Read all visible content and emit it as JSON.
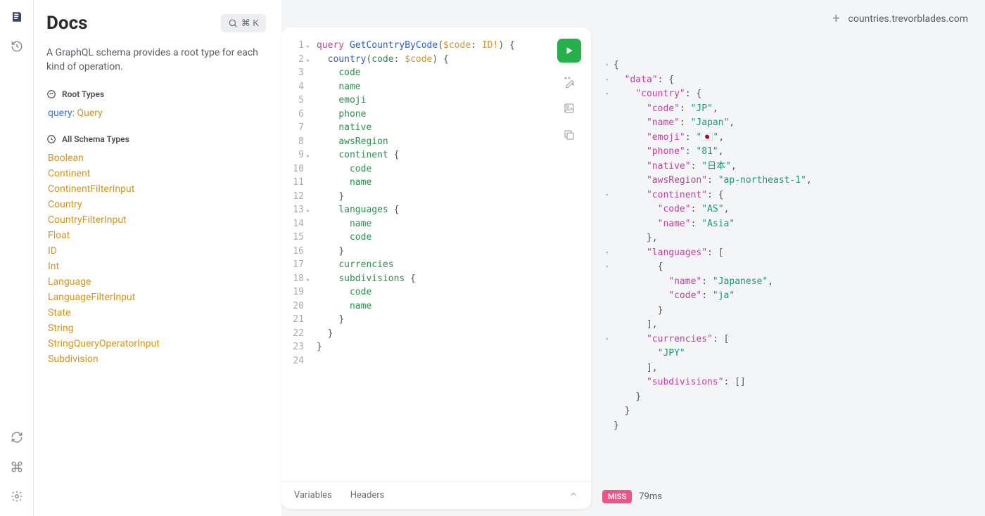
{
  "docs": {
    "title": "Docs",
    "description": "A GraphQL schema provides a root type for each kind of operation.",
    "search_shortcut": "⌘ K",
    "root_types_label": "Root Types",
    "root_type": {
      "label": "query:",
      "type": "Query"
    },
    "all_schema_types_label": "All Schema Types",
    "schema_types": [
      "Boolean",
      "Continent",
      "ContinentFilterInput",
      "Country",
      "CountryFilterInput",
      "Float",
      "ID",
      "Int",
      "Language",
      "LanguageFilterInput",
      "State",
      "String",
      "StringQueryOperatorInput",
      "Subdivision"
    ]
  },
  "endpoint": "countries.trevorblades.com",
  "editor": {
    "lines": [
      {
        "num": "1",
        "fold": true,
        "tokens": [
          [
            "kw",
            "query "
          ],
          [
            "name",
            "GetCountryByCode"
          ],
          [
            "punc",
            "("
          ],
          [
            "var",
            "$code"
          ],
          [
            "punc",
            ": "
          ],
          [
            "type",
            "ID!"
          ],
          [
            "punc",
            ") {"
          ]
        ]
      },
      {
        "num": "2",
        "fold": true,
        "indent": 1,
        "tokens": [
          [
            "name",
            "country"
          ],
          [
            "punc",
            "("
          ],
          [
            "prop",
            "code"
          ],
          [
            "punc",
            ": "
          ],
          [
            "var",
            "$code"
          ],
          [
            "punc",
            ") {"
          ]
        ]
      },
      {
        "num": "3",
        "indent": 2,
        "tokens": [
          [
            "prop",
            "code"
          ]
        ]
      },
      {
        "num": "4",
        "indent": 2,
        "tokens": [
          [
            "prop",
            "name"
          ]
        ]
      },
      {
        "num": "5",
        "indent": 2,
        "tokens": [
          [
            "prop",
            "emoji"
          ]
        ]
      },
      {
        "num": "6",
        "indent": 2,
        "tokens": [
          [
            "prop",
            "phone"
          ]
        ]
      },
      {
        "num": "7",
        "indent": 2,
        "tokens": [
          [
            "prop",
            "native"
          ]
        ]
      },
      {
        "num": "8",
        "indent": 2,
        "tokens": [
          [
            "prop",
            "awsRegion"
          ]
        ]
      },
      {
        "num": "9",
        "fold": true,
        "indent": 2,
        "tokens": [
          [
            "prop",
            "continent"
          ],
          [
            "punc",
            " {"
          ]
        ]
      },
      {
        "num": "10",
        "indent": 3,
        "tokens": [
          [
            "prop",
            "code"
          ]
        ]
      },
      {
        "num": "11",
        "indent": 3,
        "tokens": [
          [
            "prop",
            "name"
          ]
        ]
      },
      {
        "num": "12",
        "indent": 2,
        "tokens": [
          [
            "punc",
            "}"
          ]
        ]
      },
      {
        "num": "13",
        "fold": true,
        "indent": 2,
        "tokens": [
          [
            "prop",
            "languages"
          ],
          [
            "punc",
            " {"
          ]
        ]
      },
      {
        "num": "14",
        "indent": 3,
        "tokens": [
          [
            "prop",
            "name"
          ]
        ]
      },
      {
        "num": "15",
        "indent": 3,
        "tokens": [
          [
            "prop",
            "code"
          ]
        ]
      },
      {
        "num": "16",
        "indent": 2,
        "tokens": [
          [
            "punc",
            "}"
          ]
        ]
      },
      {
        "num": "17",
        "indent": 2,
        "tokens": [
          [
            "prop",
            "currencies"
          ]
        ]
      },
      {
        "num": "18",
        "fold": true,
        "indent": 2,
        "tokens": [
          [
            "prop",
            "subdivisions"
          ],
          [
            "punc",
            " {"
          ]
        ]
      },
      {
        "num": "19",
        "indent": 3,
        "tokens": [
          [
            "prop",
            "code"
          ]
        ]
      },
      {
        "num": "20",
        "indent": 3,
        "tokens": [
          [
            "prop",
            "name"
          ]
        ]
      },
      {
        "num": "21",
        "indent": 2,
        "tokens": [
          [
            "punc",
            "}"
          ]
        ]
      },
      {
        "num": "22",
        "indent": 1,
        "tokens": [
          [
            "punc",
            "}"
          ]
        ]
      },
      {
        "num": "23",
        "indent": 0,
        "tokens": [
          [
            "punc",
            "}"
          ]
        ]
      },
      {
        "num": "24",
        "indent": 0,
        "tokens": []
      }
    ],
    "footer": {
      "variables": "Variables",
      "headers": "Headers"
    }
  },
  "response": {
    "lines": [
      {
        "arrow": true,
        "indent": 0,
        "tokens": [
          [
            "jp",
            "{"
          ]
        ]
      },
      {
        "arrow": true,
        "indent": 1,
        "tokens": [
          [
            "jk",
            "\"data\""
          ],
          [
            "jp",
            ": {"
          ]
        ]
      },
      {
        "arrow": true,
        "indent": 2,
        "tokens": [
          [
            "jk",
            "\"country\""
          ],
          [
            "jp",
            ": {"
          ]
        ]
      },
      {
        "indent": 3,
        "tokens": [
          [
            "jk",
            "\"code\""
          ],
          [
            "jp",
            ": "
          ],
          [
            "jv",
            "\"JP\""
          ],
          [
            "jp",
            ","
          ]
        ]
      },
      {
        "indent": 3,
        "tokens": [
          [
            "jk",
            "\"name\""
          ],
          [
            "jp",
            ": "
          ],
          [
            "jv",
            "\"Japan\""
          ],
          [
            "jp",
            ","
          ]
        ]
      },
      {
        "indent": 3,
        "tokens": [
          [
            "jk",
            "\"emoji\""
          ],
          [
            "jp",
            ": "
          ],
          [
            "jv",
            "\"🇯🇵\""
          ],
          [
            "jp",
            ","
          ]
        ]
      },
      {
        "indent": 3,
        "tokens": [
          [
            "jk",
            "\"phone\""
          ],
          [
            "jp",
            ": "
          ],
          [
            "jv",
            "\"81\""
          ],
          [
            "jp",
            ","
          ]
        ]
      },
      {
        "indent": 3,
        "tokens": [
          [
            "jk",
            "\"native\""
          ],
          [
            "jp",
            ": "
          ],
          [
            "jv",
            "\"日本\""
          ],
          [
            "jp",
            ","
          ]
        ]
      },
      {
        "indent": 3,
        "tokens": [
          [
            "jk",
            "\"awsRegion\""
          ],
          [
            "jp",
            ": "
          ],
          [
            "jv",
            "\"ap-northeast-1\""
          ],
          [
            "jp",
            ","
          ]
        ]
      },
      {
        "arrow": true,
        "indent": 3,
        "tokens": [
          [
            "jk",
            "\"continent\""
          ],
          [
            "jp",
            ": {"
          ]
        ]
      },
      {
        "indent": 4,
        "tokens": [
          [
            "jk",
            "\"code\""
          ],
          [
            "jp",
            ": "
          ],
          [
            "jv",
            "\"AS\""
          ],
          [
            "jp",
            ","
          ]
        ]
      },
      {
        "indent": 4,
        "tokens": [
          [
            "jk",
            "\"name\""
          ],
          [
            "jp",
            ": "
          ],
          [
            "jv",
            "\"Asia\""
          ]
        ]
      },
      {
        "indent": 3,
        "tokens": [
          [
            "jp",
            "},"
          ]
        ]
      },
      {
        "arrow": true,
        "indent": 3,
        "tokens": [
          [
            "jk",
            "\"languages\""
          ],
          [
            "jp",
            ": ["
          ]
        ]
      },
      {
        "arrow": true,
        "indent": 4,
        "tokens": [
          [
            "jp",
            "{"
          ]
        ]
      },
      {
        "indent": 5,
        "tokens": [
          [
            "jk",
            "\"name\""
          ],
          [
            "jp",
            ": "
          ],
          [
            "jv",
            "\"Japanese\""
          ],
          [
            "jp",
            ","
          ]
        ]
      },
      {
        "indent": 5,
        "tokens": [
          [
            "jk",
            "\"code\""
          ],
          [
            "jp",
            ": "
          ],
          [
            "jv",
            "\"ja\""
          ]
        ]
      },
      {
        "indent": 4,
        "tokens": [
          [
            "jp",
            "}"
          ]
        ]
      },
      {
        "indent": 3,
        "tokens": [
          [
            "jp",
            "],"
          ]
        ]
      },
      {
        "arrow": true,
        "indent": 3,
        "tokens": [
          [
            "jk",
            "\"currencies\""
          ],
          [
            "jp",
            ": ["
          ]
        ]
      },
      {
        "indent": 4,
        "tokens": [
          [
            "jv",
            "\"JPY\""
          ]
        ]
      },
      {
        "indent": 3,
        "tokens": [
          [
            "jp",
            "],"
          ]
        ]
      },
      {
        "indent": 3,
        "tokens": [
          [
            "jk",
            "\"subdivisions\""
          ],
          [
            "jp",
            ": []"
          ]
        ]
      },
      {
        "indent": 2,
        "tokens": [
          [
            "jp",
            "}"
          ]
        ]
      },
      {
        "indent": 1,
        "tokens": [
          [
            "jp",
            "}"
          ]
        ]
      },
      {
        "indent": 0,
        "tokens": [
          [
            "jp",
            "}"
          ]
        ]
      }
    ],
    "badge": "MISS",
    "timing": "79ms"
  }
}
